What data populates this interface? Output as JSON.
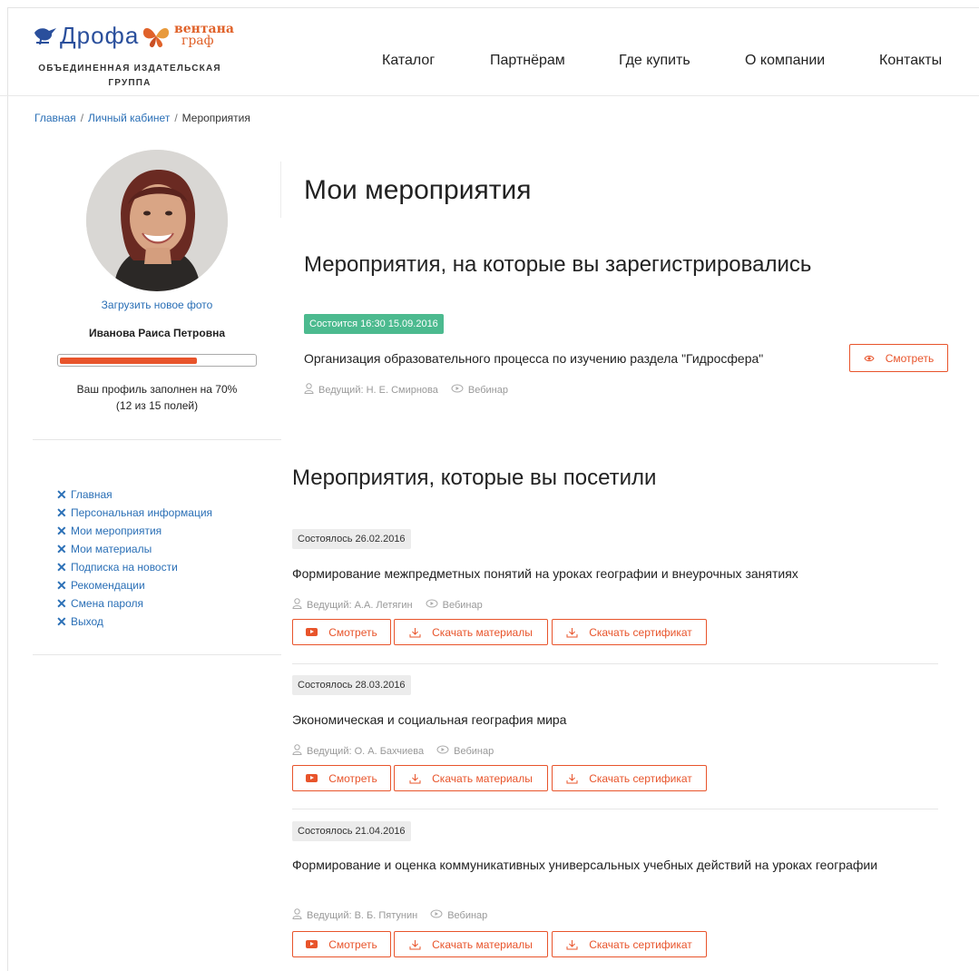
{
  "logo": {
    "drofa": "Дрофа",
    "ventana_line1": "вентана",
    "ventana_line2": "граф",
    "subtitle_line1": "ОБЪЕДИНЕННАЯ ИЗДАТЕЛЬСКАЯ",
    "subtitle_line2": "ГРУППА",
    "colors": {
      "drofa": "#2a4f9c",
      "ventana": "#e0622a"
    }
  },
  "nav": [
    {
      "label": "Каталог"
    },
    {
      "label": "Партнёрам"
    },
    {
      "label": "Где купить"
    },
    {
      "label": "О компании"
    },
    {
      "label": "Контакты"
    }
  ],
  "breadcrumb": {
    "items": [
      "Главная",
      "Личный кабинет",
      "Мероприятия"
    ],
    "separator": "/"
  },
  "profile": {
    "upload_photo": "Загрузить новое фото",
    "name": "Иванова Раиса Петровна",
    "progress_percent": 70,
    "progress_text": "Ваш профиль заполнен на 70%",
    "fields_text": "(12 из 15 полей)"
  },
  "sidebar_menu": [
    {
      "label": "Главная",
      "icon": "x-icon"
    },
    {
      "label": "Персональная информация",
      "icon": "x-icon"
    },
    {
      "label": "Мои мероприятия",
      "icon": "x-icon"
    },
    {
      "label": "Мои материалы",
      "icon": "x-icon"
    },
    {
      "label": "Подписка на новости",
      "icon": "x-icon"
    },
    {
      "label": "Рекомендации",
      "icon": "x-icon"
    },
    {
      "label": "Смена пароля",
      "icon": "x-icon"
    },
    {
      "label": "Выход",
      "icon": "x-icon"
    }
  ],
  "main": {
    "title": "Мои мероприятия",
    "registered": {
      "heading": "Мероприятия, на которые вы зарегистрировались",
      "events": [
        {
          "status": "Состоится 16:30 15.09.2016",
          "title": "Организация образовательного процесса по изучению раздела \"Гидросфера\"",
          "host": "Ведущий: Н. Е. Смирнова",
          "type": "Вебинар",
          "watch_label": "Смотреть"
        }
      ]
    },
    "attended": {
      "heading": "Мероприятия, которые вы посетили",
      "events": [
        {
          "status": "Состоялось 26.02.2016",
          "title": "Формирование межпредметных понятий на уроках географии и внеурочных занятиях",
          "host": "Ведущий: А.А. Летягин",
          "type": "Вебинар",
          "watch_label": "Смотреть",
          "materials_label": "Скачать материалы",
          "certificate_label": "Скачать сертификат"
        },
        {
          "status": "Состоялось 28.03.2016",
          "title": "Экономическая и социальная география мира",
          "host": "Ведущий: О. А. Бахчиева",
          "type": "Вебинар",
          "watch_label": "Смотреть",
          "materials_label": "Скачать материалы",
          "certificate_label": "Скачать сертификат"
        },
        {
          "status": "Состоялось 21.04.2016",
          "title": "Формирование и оценка коммуникативных универсальных учебных действий на уроках географии",
          "host": "Ведущий: В. Б. Пятунин",
          "type": "Вебинар",
          "watch_label": "Смотреть",
          "materials_label": "Скачать материалы",
          "certificate_label": "Скачать сертификат"
        }
      ]
    }
  },
  "colors": {
    "accent": "#e8542b",
    "link": "#2a6fb6",
    "upcoming_badge": "#4cba8f",
    "past_badge": "#ececec"
  }
}
